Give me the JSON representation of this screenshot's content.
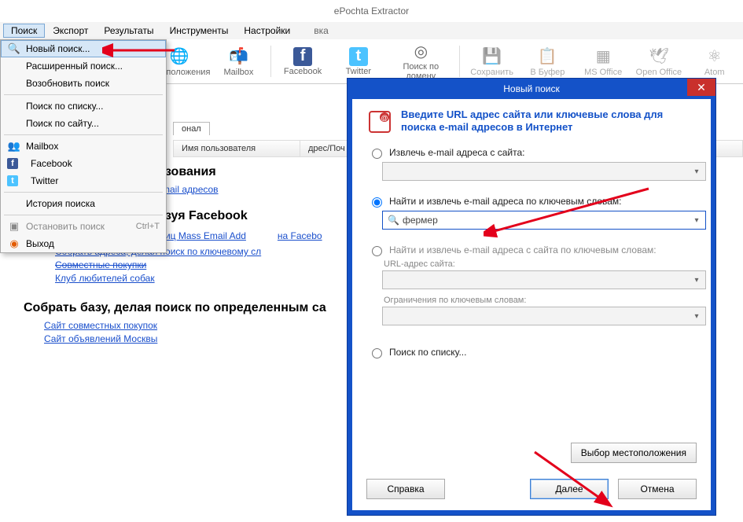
{
  "app_title": "ePochta Extractor",
  "menubar": {
    "items": [
      "Поиск",
      "Экспорт",
      "Результаты",
      "Инструменты",
      "Настройки"
    ],
    "extra_label": "вка"
  },
  "toolbar": {
    "items": [
      {
        "label": "естоположения",
        "icon": "globe"
      },
      {
        "label": "Mailbox",
        "icon": "mailbox"
      },
      {
        "label": "Facebook",
        "icon": "fb"
      },
      {
        "label": "Twitter",
        "icon": "tw"
      },
      {
        "label": "Поиск по домену",
        "icon": "target"
      },
      {
        "label": "Сохранить",
        "icon": "save"
      },
      {
        "label": "В Буфер",
        "icon": "clipboard"
      },
      {
        "label": "MS Office",
        "icon": "office"
      },
      {
        "label": "Open Office",
        "icon": "openoffice"
      },
      {
        "label": "Atom",
        "icon": "atom"
      }
    ]
  },
  "tab": {
    "label": "онал"
  },
  "table": {
    "cols": [
      "Имя пользователя",
      "дрес/Поч"
    ]
  },
  "dropdown": {
    "new_search": "Новый поиск...",
    "advanced": "Расширенный поиск...",
    "resume": "Возобновить поиск",
    "by_list": "Поиск по списку...",
    "by_site": "Поиск по сайту...",
    "mailbox": "Mailbox",
    "facebook": "Facebook",
    "twitter": "Twitter",
    "history": "История поиска",
    "stop": "Остановить поиск",
    "stop_shortcut": "Ctrl+T",
    "exit": "Выход"
  },
  "content": {
    "h1": "льзования",
    "l1": "у email адресов",
    "h2": "льзуя Facebook",
    "l2": "раниц Mass Email Add",
    "side1": "на Facebo",
    "l3": "Собрать адреса, делая поиск по ключевому сл",
    "l4": "Совместные покупки",
    "l5": "Клуб любителей собак",
    "h3": "Собрать базу, делая поиск по определенным са",
    "l6": "Сайт совместных покупок",
    "l7": "Сайт объявлений Москвы"
  },
  "dialog": {
    "title": "Новый поиск",
    "header": "Введите URL адрес сайта или ключевые слова для поиска e-mail адресов в Интернет",
    "opt1": "Извлечь e-mail адреса с сайта:",
    "opt2": "Найти и извлечь e-mail адреса по ключевым словам:",
    "opt2_value": "фермер",
    "opt3": "Найти и извлечь e-mail адреса с сайта по ключевым словам:",
    "opt3_sub1": "URL-адрес сайта:",
    "opt3_sub2": "Ограничения по ключевым словам:",
    "opt4": "Поиск по списку...",
    "loc_btn": "Выбор местоположения",
    "help": "Справка",
    "next": "Далее",
    "cancel": "Отмена"
  }
}
